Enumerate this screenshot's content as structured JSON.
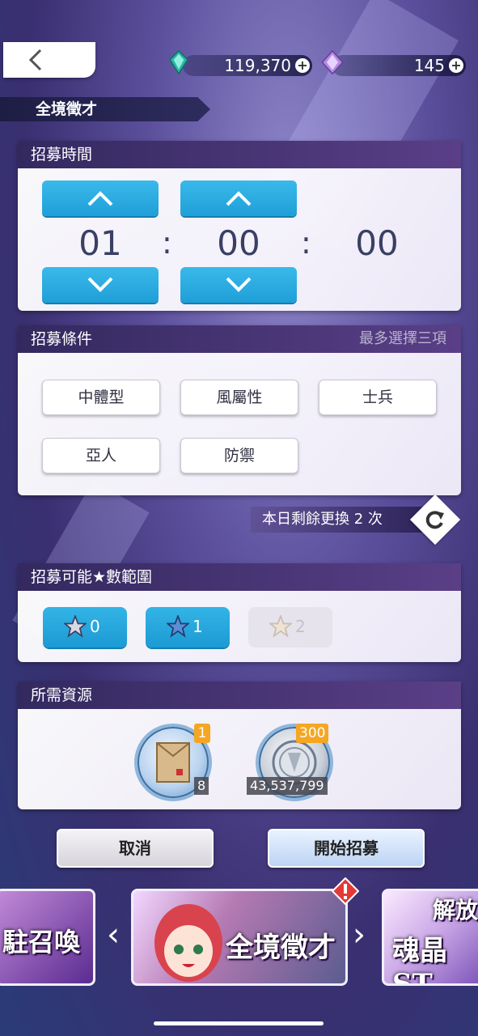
{
  "header": {
    "page_title": "全境徵才",
    "currencies": [
      {
        "name": "diamond",
        "value": "119,370",
        "icon": "gem-icon",
        "color": "#2fb3a6"
      },
      {
        "name": "soul-crystal",
        "value": "145",
        "icon": "crystal-icon",
        "color": "#b48be0"
      }
    ]
  },
  "time_panel": {
    "title": "招募時間",
    "hours": "01",
    "minutes": "00",
    "seconds": "00",
    "separator": ":"
  },
  "conditions_panel": {
    "title": "招募條件",
    "hint": "最多選擇三項",
    "options": [
      "中體型",
      "風屬性",
      "士兵",
      "亞人",
      "防禦"
    ],
    "refresh_text": "本日剩餘更換 2 次"
  },
  "star_panel": {
    "title": "招募可能★數範圍",
    "stars": [
      {
        "label": "0",
        "enabled": true
      },
      {
        "label": "1",
        "enabled": true
      },
      {
        "label": "2",
        "enabled": false
      }
    ]
  },
  "resource_panel": {
    "title": "所需資源",
    "items": [
      {
        "name": "envelope",
        "cost": "1",
        "owned": "8"
      },
      {
        "name": "coin",
        "cost": "300",
        "owned": "43,537,799"
      }
    ]
  },
  "actions": {
    "cancel": "取消",
    "start": "開始招募"
  },
  "banners": {
    "left": "駐召喚",
    "center": "全境徵才",
    "right_top": "解放",
    "right_bottom": "魂晶ST"
  }
}
